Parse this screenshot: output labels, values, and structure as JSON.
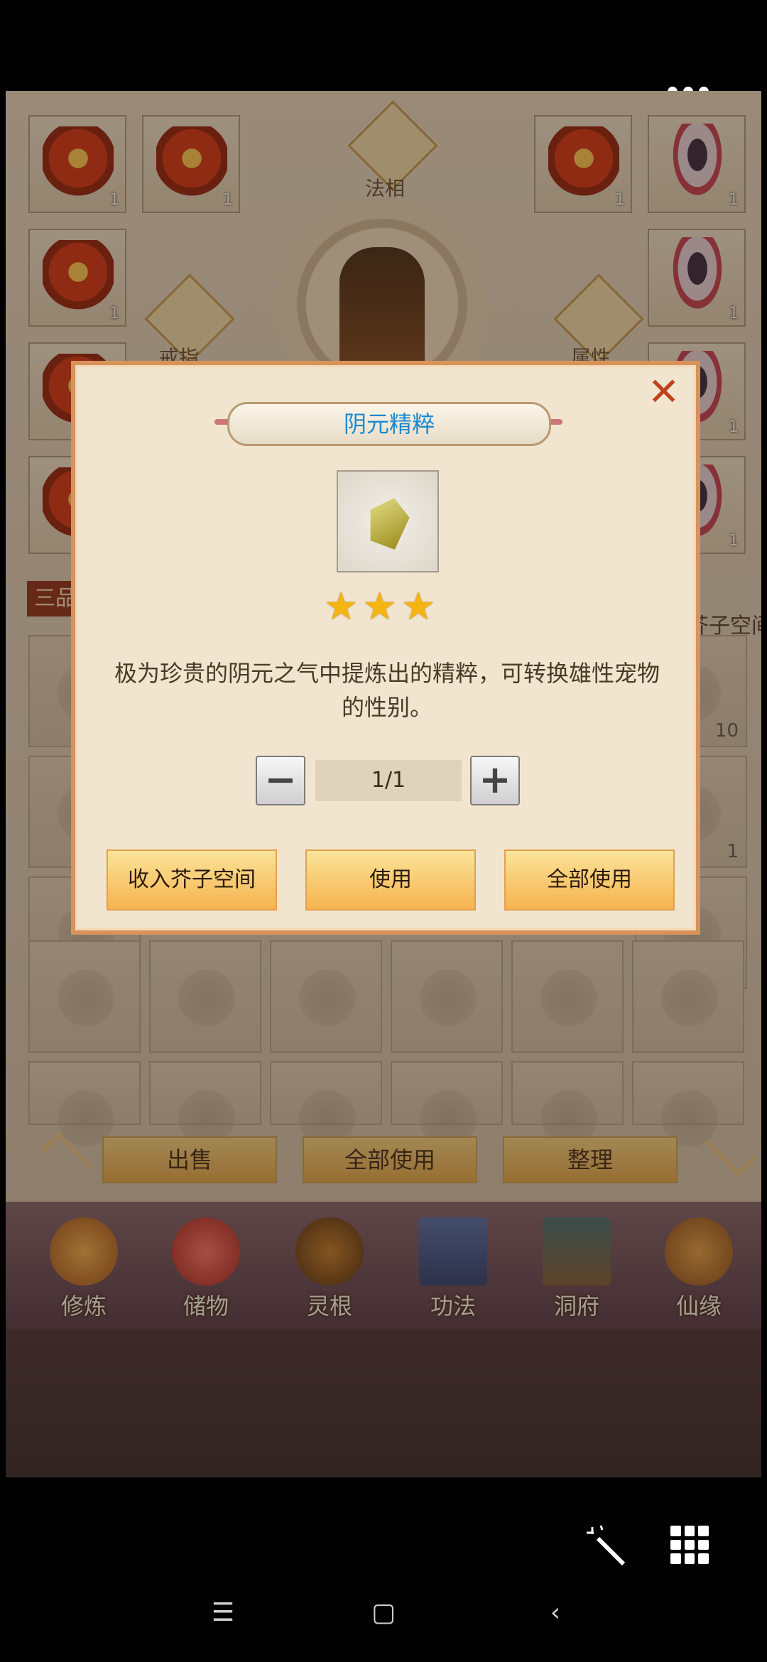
{
  "top": {
    "more_icon": "more-dots-icon"
  },
  "equipment": {
    "center_labels": {
      "top": "法相",
      "left": "戒指",
      "right": "属性"
    },
    "slot_count": "1",
    "side_tab_left": "三品",
    "side_tab_right": "芥子空间",
    "stack_count_10": "10",
    "stack_count_1": "1"
  },
  "bottom_actions": {
    "sell": "出售",
    "use_all": "全部使用",
    "sort": "整理"
  },
  "nav": [
    {
      "label": "修炼",
      "icon": "monk-icon"
    },
    {
      "label": "储物",
      "icon": "bag-icon"
    },
    {
      "label": "灵根",
      "icon": "root-icon"
    },
    {
      "label": "功法",
      "icon": "book-icon"
    },
    {
      "label": "洞府",
      "icon": "cave-icon"
    },
    {
      "label": "仙缘",
      "icon": "gourd-icon"
    }
  ],
  "dialog": {
    "title": "阴元精粹",
    "stars": 3,
    "star_glyph": "★",
    "description": "极为珍贵的阴元之气中提炼出的精粹，可转换雄性宠物的性别。",
    "quantity": "1/1",
    "minus": "−",
    "plus": "+",
    "close": "✕",
    "btn_store": "收入芥子空间",
    "btn_use": "使用",
    "btn_use_all": "全部使用"
  },
  "system_nav": {
    "menu": "☰",
    "home": "▢",
    "back": "‹"
  }
}
